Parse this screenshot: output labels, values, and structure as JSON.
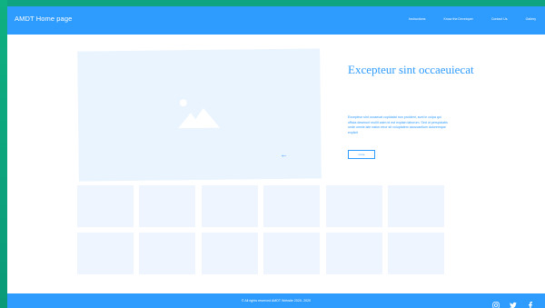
{
  "header": {
    "brand": "AMDT Home page",
    "nav": [
      "Instructions",
      "Know the Developer",
      "Contact Us",
      "Gallery"
    ]
  },
  "hero": {
    "title": "Excepteur sint occaeuiecat",
    "description": "Excepteur sint occaecat cupidatat non proident, sunt in culpa qui officia deserunt mollit anim id est explain laborum. Sed ut perspiciatis unde omnis iste natus error sit voluptatem accusantium doloremque explicit",
    "button_label": "more",
    "arrow_icon": "arrow-left-icon"
  },
  "gallery": {
    "tiles": 12
  },
  "footer": {
    "copyright": "© All rights reserved AMDT Website 2020- 2020",
    "social": [
      "instagram-icon",
      "twitter-icon",
      "facebook-icon"
    ]
  },
  "colors": {
    "accent": "#2e9bff",
    "placeholder": "#eaf4fe",
    "frame": "#10a37f"
  }
}
